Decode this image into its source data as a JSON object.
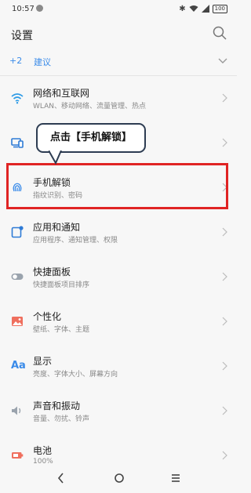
{
  "status_bar": {
    "time": "10:57",
    "battery": "100"
  },
  "header": {
    "title": "设置",
    "search_icon": "search-icon"
  },
  "suggestions": {
    "count": "+2",
    "label": "建议"
  },
  "settings_items": [
    {
      "title": "网络和互联网",
      "subtitle": "WLAN、移动网络、流量管理、热点",
      "icon": "wifi-icon"
    },
    {
      "title": "",
      "subtitle": "",
      "icon": "devices-icon"
    },
    {
      "title": "手机解锁",
      "subtitle": "指纹识别、密码",
      "icon": "fingerprint-icon"
    },
    {
      "title": "应用和通知",
      "subtitle": "应用程序、通知管理、权限",
      "icon": "apps-notification-icon"
    },
    {
      "title": "快捷面板",
      "subtitle": "快捷面板项目排序",
      "icon": "toggle-icon"
    },
    {
      "title": "个性化",
      "subtitle": "壁纸、字体、主题",
      "icon": "image-icon"
    },
    {
      "title": "显示",
      "subtitle": "亮度、字体大小、屏幕方向",
      "icon": "font-size-icon"
    },
    {
      "title": "声音和振动",
      "subtitle": "音量、勿扰、铃声",
      "icon": "speaker-icon"
    },
    {
      "title": "电池",
      "subtitle": "100%",
      "icon": "battery-icon"
    }
  ],
  "callout": {
    "text": "点击【手机解锁】"
  },
  "colors": {
    "accent": "#3a8be9",
    "highlight": "#e02424"
  }
}
